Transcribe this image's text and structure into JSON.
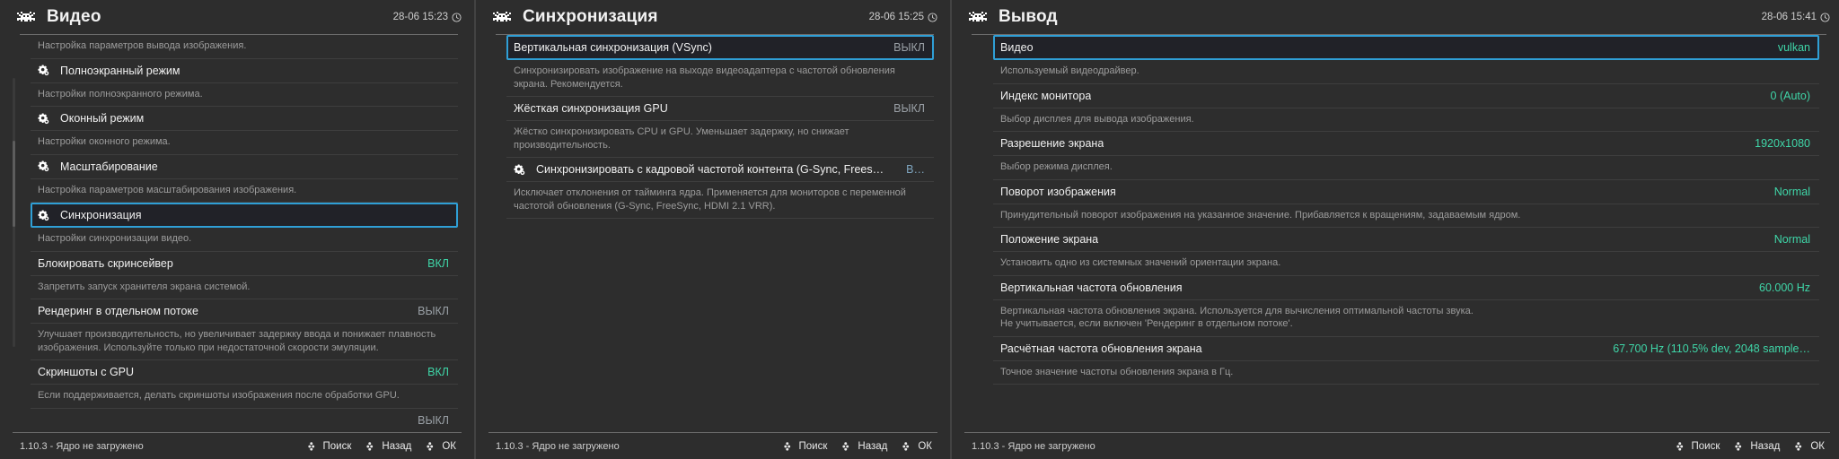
{
  "theme": {
    "bg": "#2d2d2d",
    "selected_border": "#2f9fd6",
    "selected_bg": "#212228",
    "value_accent": "#3fd6a8",
    "value_muted": "#9aa0a6",
    "sublabel": "#9c9c9c",
    "rule": "#6c6c6c"
  },
  "panels": [
    {
      "id": "video",
      "icon": "space-invader-icon",
      "title": "Видео",
      "clock": "28-06 15:23",
      "clock_icon": "clock-icon",
      "rows": [
        {
          "kind": "sub",
          "text": "Настройка параметров вывода изображения."
        },
        {
          "kind": "row",
          "icon": "gear-icon",
          "label": "Полноэкранный режим",
          "value": "",
          "selected": false
        },
        {
          "kind": "sub",
          "text": "Настройки полноэкранного режима."
        },
        {
          "kind": "row",
          "icon": "gear-icon",
          "label": "Оконный режим",
          "value": "",
          "selected": false
        },
        {
          "kind": "sub",
          "text": "Настройки оконного режима."
        },
        {
          "kind": "row",
          "icon": "gear-icon",
          "label": "Масштабирование",
          "value": "",
          "selected": false
        },
        {
          "kind": "sub",
          "text": "Настройка параметров масштабирования изображения."
        },
        {
          "kind": "row",
          "icon": "gear-icon",
          "label": "Синхронизация",
          "value": "",
          "selected": true
        },
        {
          "kind": "sub",
          "text": "Настройки синхронизации видео."
        },
        {
          "kind": "row",
          "icon": "",
          "label": "Блокировать скринсейвер",
          "value": "ВКЛ",
          "value_style": "on",
          "selected": false
        },
        {
          "kind": "sub",
          "text": "Запретить запуск хранителя экрана системой."
        },
        {
          "kind": "row",
          "icon": "",
          "label": "Рендеринг в отдельном потоке",
          "value": "ВЫКЛ",
          "value_style": "off",
          "selected": false
        },
        {
          "kind": "sub",
          "text": "Улучшает производительность, но увеличивает задержку ввода и понижает плавность изображения. Используйте только при недостаточной скорости эмуляции."
        },
        {
          "kind": "row",
          "icon": "",
          "label": "Скриншоты с GPU",
          "value": "ВКЛ",
          "value_style": "on",
          "selected": false
        },
        {
          "kind": "sub",
          "text": "Если поддерживается, делать скриншоты изображения после обработки GPU."
        },
        {
          "kind": "row",
          "icon": "",
          "label": "",
          "value": "ВЫКЛ",
          "value_style": "off",
          "selected": false,
          "clipped": true
        }
      ],
      "footer": {
        "version": "1.10.3 - Ядро не загружено",
        "nav": [
          {
            "icon": "gamepad-icon",
            "label": "Поиск"
          },
          {
            "icon": "gamepad-icon",
            "label": "Назад"
          },
          {
            "icon": "gamepad-icon",
            "label": "ОК"
          }
        ]
      }
    },
    {
      "id": "sync",
      "icon": "space-invader-icon",
      "title": "Синхронизация",
      "clock": "28-06 15:25",
      "clock_icon": "clock-icon",
      "rows": [
        {
          "kind": "row",
          "icon": "",
          "label": "Вертикальная синхронизация (VSync)",
          "value": "ВЫКЛ",
          "value_style": "off",
          "selected": true
        },
        {
          "kind": "sub",
          "text": "Синхронизировать изображение на выходе видеоадаптера с частотой обновления экрана. Рекомендуется."
        },
        {
          "kind": "row",
          "icon": "",
          "label": "Жёсткая синхронизация GPU",
          "value": "ВЫКЛ",
          "value_style": "off",
          "selected": false
        },
        {
          "kind": "sub",
          "text": "Жёстко синхронизировать CPU и GPU. Уменьшает задержку, но снижает производительность."
        },
        {
          "kind": "row",
          "icon": "gear-icon",
          "label": "Синхронизировать с кадровой частотой контента (G-Sync, Frees…",
          "value": "В…",
          "value_style": "dim",
          "selected": false
        },
        {
          "kind": "sub",
          "text": "Исключает отклонения от тайминга ядра. Применяется для мониторов с переменной частотой обновления (G-Sync, FreeSync, HDMI 2.1 VRR)."
        }
      ],
      "footer": {
        "version": "1.10.3 - Ядро не загружено",
        "nav": [
          {
            "icon": "gamepad-icon",
            "label": "Поиск"
          },
          {
            "icon": "gamepad-icon",
            "label": "Назад"
          },
          {
            "icon": "gamepad-icon",
            "label": "ОК"
          }
        ]
      }
    },
    {
      "id": "output",
      "icon": "space-invader-icon",
      "title": "Вывод",
      "clock": "28-06 15:41",
      "clock_icon": "clock-icon",
      "rows": [
        {
          "kind": "row",
          "icon": "",
          "label": "Видео",
          "value": "vulkan",
          "value_style": "val",
          "selected": true
        },
        {
          "kind": "sub",
          "text": "Используемый видеодрайвер."
        },
        {
          "kind": "row",
          "icon": "",
          "label": "Индекс монитора",
          "value": "0 (Auto)",
          "value_style": "val",
          "selected": false
        },
        {
          "kind": "sub",
          "text": "Выбор дисплея для вывода изображения."
        },
        {
          "kind": "row",
          "icon": "",
          "label": "Разрешение экрана",
          "value": "1920x1080",
          "value_style": "val",
          "selected": false
        },
        {
          "kind": "sub",
          "text": "Выбор режима дисплея."
        },
        {
          "kind": "row",
          "icon": "",
          "label": "Поворот изображения",
          "value": "Normal",
          "value_style": "val",
          "selected": false
        },
        {
          "kind": "sub",
          "text": "Принудительный поворот изображения на указанное значение. Прибавляется к вращениям, задаваемым ядром."
        },
        {
          "kind": "row",
          "icon": "",
          "label": "Положение экрана",
          "value": "Normal",
          "value_style": "val",
          "selected": false
        },
        {
          "kind": "sub",
          "text": "Установить одно из системных значений ориентации экрана."
        },
        {
          "kind": "row",
          "icon": "",
          "label": "Вертикальная частота обновления",
          "value": "60.000 Hz",
          "value_style": "val",
          "selected": false
        },
        {
          "kind": "sub",
          "text": "Вертикальная частота обновления экрана. Используется для вычисления оптимальной частоты звука.\nНе учитывается, если включен 'Рендеринг в отдельном потоке'."
        },
        {
          "kind": "row",
          "icon": "",
          "label": "Расчётная частота обновления экрана",
          "value": "67.700 Hz (110.5% dev, 2048 sample…",
          "value_style": "val",
          "selected": false
        },
        {
          "kind": "sub",
          "text": "Точное значение частоты обновления экрана в Гц."
        }
      ],
      "footer": {
        "version": "1.10.3 - Ядро не загружено",
        "nav": [
          {
            "icon": "gamepad-icon",
            "label": "Поиск"
          },
          {
            "icon": "gamepad-icon",
            "label": "Назад"
          },
          {
            "icon": "gamepad-icon",
            "label": "ОК"
          }
        ]
      }
    }
  ]
}
